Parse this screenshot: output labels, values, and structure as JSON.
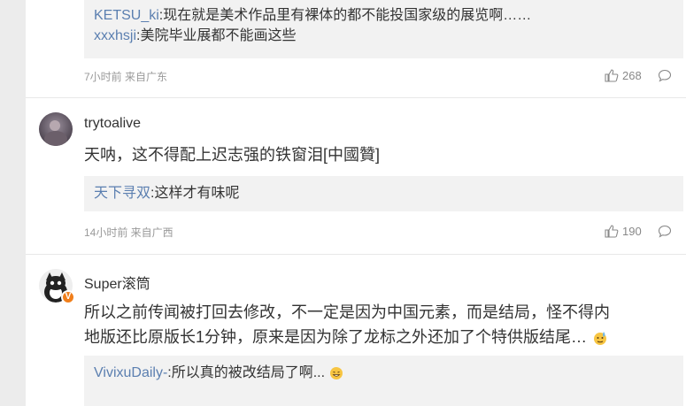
{
  "comment1": {
    "replies": [
      {
        "user": "KETSU_ki",
        "text": ":现在就是美术作品里有裸体的都不能投国家级的展览啊……"
      },
      {
        "user": "xxxhsji",
        "text": ":美院毕业展都不能画这些"
      }
    ],
    "time": "7小时前 来自广东",
    "likes": "268"
  },
  "comment2": {
    "username": "trytoalive",
    "text": "天呐，这不得配上迟志强的铁窗泪[中國贊]",
    "replies": [
      {
        "user": "天下寻双",
        "text": ":这样才有味呢"
      }
    ],
    "time": "14小时前 来自广西",
    "likes": "190"
  },
  "comment3": {
    "username": "Super滚筒",
    "badge": "V",
    "text_line1": "所以之前传闻被打回去修改，不一定是因为中国元素，而是结局，怪不得内",
    "text_line2": "地版还比原版长1分钟，原来是因为除了龙标之外还加了个特供版结尾…",
    "replies": [
      {
        "user": "VivixuDaily-",
        "text": ":所以真的被改结局了啊..."
      }
    ]
  },
  "icons": {
    "like": "thumbs-up-icon",
    "comment": "comment-bubble-icon",
    "emoji_sweat": "sweat-emoji-icon",
    "emoji_haha": "grin-emoji-icon"
  },
  "colors": {
    "reply_user": "#5b7fb0",
    "reply_bg": "#f2f2f2",
    "badge": "#f07e1a"
  }
}
